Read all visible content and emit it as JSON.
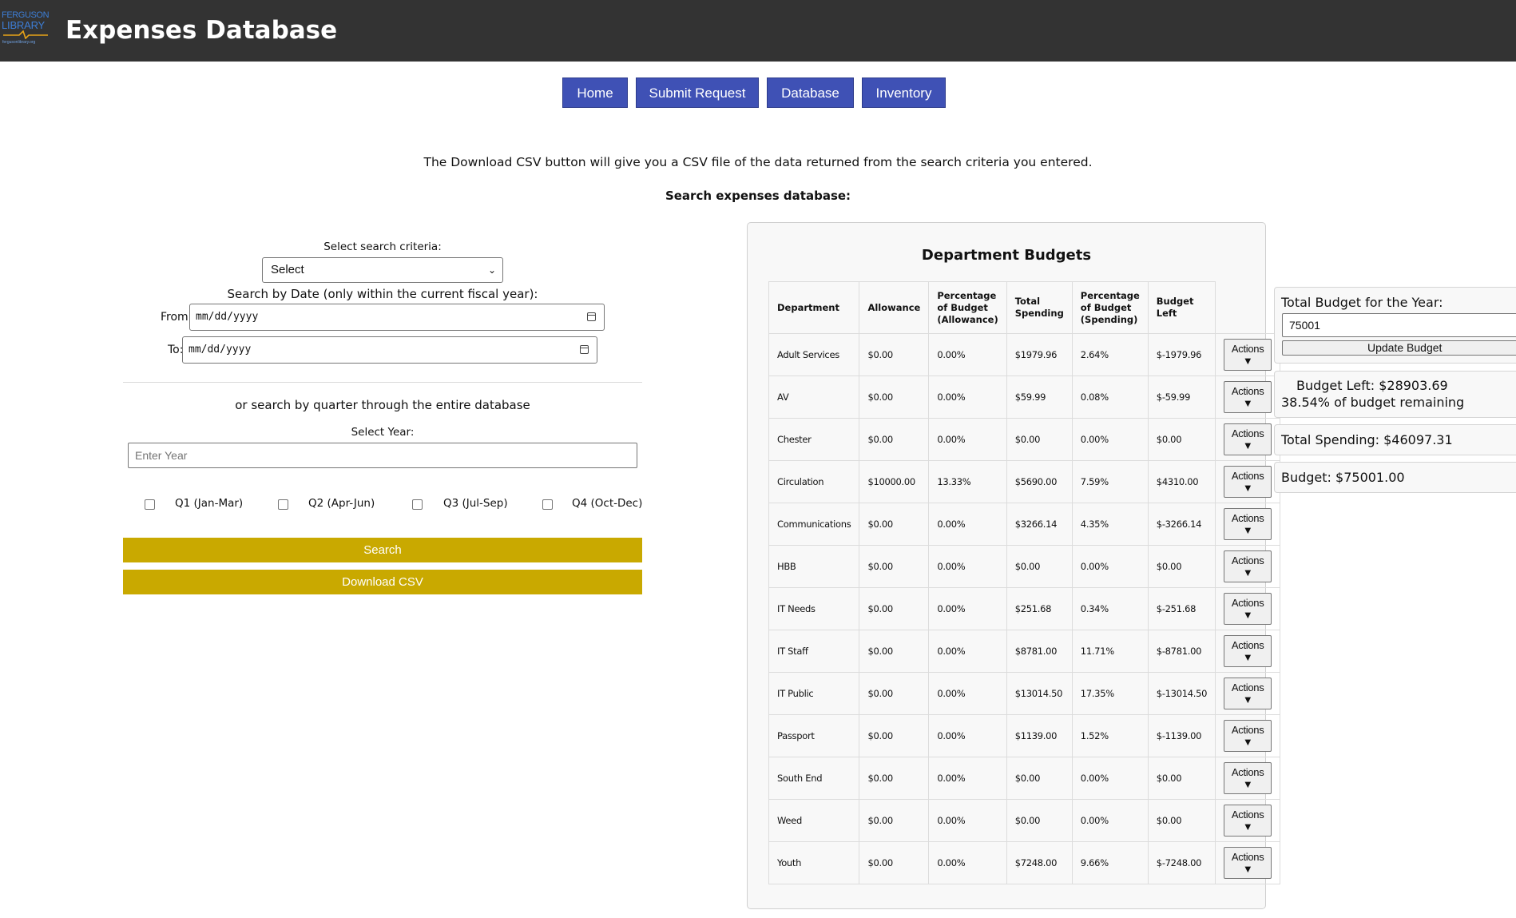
{
  "header": {
    "logo_line1": "FERGUSON",
    "logo_line2": "LIBRARY",
    "logo_url": "fergusonlibrary.org",
    "title": "Expenses Database"
  },
  "nav": {
    "home": "Home",
    "submit": "Submit Request",
    "database": "Database",
    "inventory": "Inventory"
  },
  "intro": {
    "csv_note": "The Download CSV button will give you a CSV file of the data returned from the search criteria you entered.",
    "search_heading": "Search expenses database:"
  },
  "search": {
    "criteria_label": "Select search criteria:",
    "criteria_value": "Select",
    "date_heading": "Search by Date (only within the current fiscal year):",
    "from_label": "From:",
    "to_label": "To:",
    "date_placeholder": "mm/dd/yyyy",
    "quarter_heading": "or search by quarter through the entire database",
    "year_label": "Select Year:",
    "year_placeholder": "Enter Year",
    "q1": "Q1 (Jan-Mar)",
    "q2": "Q2 (Apr-Jun)",
    "q3": "Q3 (Jul-Sep)",
    "q4": "Q4 (Oct-Dec)",
    "search_button": "Search",
    "csv_button": "Download CSV"
  },
  "budgets": {
    "title": "Department Budgets",
    "columns": [
      "Department",
      "Allowance",
      "Percentage of Budget (Allowance)",
      "Total Spending",
      "Percentage of Budget (Spending)",
      "Budget Left"
    ],
    "action_label": "Actions",
    "action_arrow": "▼",
    "rows": [
      [
        "Adult Services",
        "$0.00",
        "0.00%",
        "$1979.96",
        "2.64%",
        "$-1979.96"
      ],
      [
        "AV",
        "$0.00",
        "0.00%",
        "$59.99",
        "0.08%",
        "$-59.99"
      ],
      [
        "Chester",
        "$0.00",
        "0.00%",
        "$0.00",
        "0.00%",
        "$0.00"
      ],
      [
        "Circulation",
        "$10000.00",
        "13.33%",
        "$5690.00",
        "7.59%",
        "$4310.00"
      ],
      [
        "Communications",
        "$0.00",
        "0.00%",
        "$3266.14",
        "4.35%",
        "$-3266.14"
      ],
      [
        "HBB",
        "$0.00",
        "0.00%",
        "$0.00",
        "0.00%",
        "$0.00"
      ],
      [
        "IT Needs",
        "$0.00",
        "0.00%",
        "$251.68",
        "0.34%",
        "$-251.68"
      ],
      [
        "IT Staff",
        "$0.00",
        "0.00%",
        "$8781.00",
        "11.71%",
        "$-8781.00"
      ],
      [
        "IT Public",
        "$0.00",
        "0.00%",
        "$13014.50",
        "17.35%",
        "$-13014.50"
      ],
      [
        "Passport",
        "$0.00",
        "0.00%",
        "$1139.00",
        "1.52%",
        "$-1139.00"
      ],
      [
        "South End",
        "$0.00",
        "0.00%",
        "$0.00",
        "0.00%",
        "$0.00"
      ],
      [
        "Weed",
        "$0.00",
        "0.00%",
        "$0.00",
        "0.00%",
        "$0.00"
      ],
      [
        "Youth",
        "$0.00",
        "0.00%",
        "$7248.00",
        "9.66%",
        "$-7248.00"
      ]
    ]
  },
  "summary": {
    "total_budget_label": "Total Budget for the Year:",
    "total_budget_value": "75001",
    "update_button": "Update Budget",
    "budget_left": "Budget Left: $28903.69",
    "remaining_pct": "38.54% of budget remaining",
    "total_spending": "Total Spending: $46097.31",
    "budget": "Budget: $75001.00"
  },
  "colors": {
    "header_bg": "#333333",
    "nav_blue": "#3f51b5",
    "gold": "#c9a900"
  }
}
